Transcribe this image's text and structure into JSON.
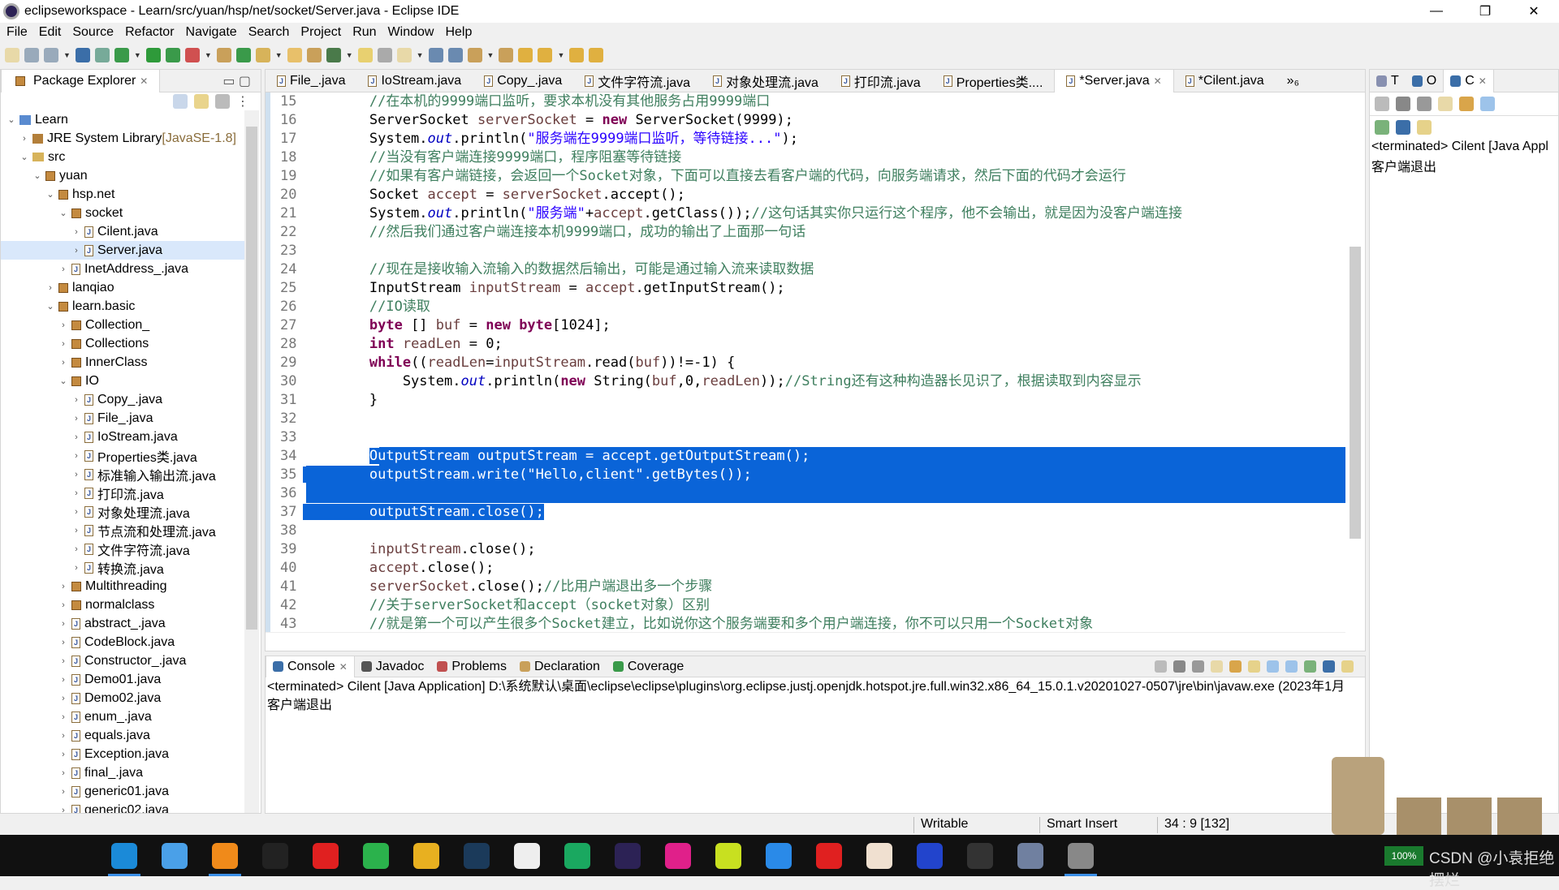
{
  "window": {
    "title": "eclipseworkspace - Learn/src/yuan/hsp/net/socket/Server.java - Eclipse IDE",
    "minimize": "—",
    "maximize": "❐",
    "close": "✕"
  },
  "menu": [
    "File",
    "Edit",
    "Source",
    "Refactor",
    "Navigate",
    "Search",
    "Project",
    "Run",
    "Window",
    "Help"
  ],
  "explorer": {
    "title": "Package Explorer",
    "items": [
      {
        "label": "Learn",
        "level": 0,
        "exp": "v",
        "icon": "proj"
      },
      {
        "label": "JRE System Library",
        "extra": " [JavaSE-1.8]",
        "level": 1,
        "exp": ">",
        "icon": "lib"
      },
      {
        "label": "src",
        "level": 1,
        "exp": "v",
        "icon": "fold"
      },
      {
        "label": "yuan",
        "level": 2,
        "exp": "v",
        "icon": "pkg"
      },
      {
        "label": "hsp.net",
        "level": 3,
        "exp": "v",
        "icon": "pkg"
      },
      {
        "label": "socket",
        "level": 4,
        "exp": "v",
        "icon": "pkg"
      },
      {
        "label": "Cilent.java",
        "level": 5,
        "exp": ">",
        "icon": "java"
      },
      {
        "label": "Server.java",
        "level": 5,
        "exp": ">",
        "icon": "java",
        "selected": true
      },
      {
        "label": "InetAddress_.java",
        "level": 4,
        "exp": ">",
        "icon": "java"
      },
      {
        "label": "lanqiao",
        "level": 3,
        "exp": ">",
        "icon": "pkg"
      },
      {
        "label": "learn.basic",
        "level": 3,
        "exp": "v",
        "icon": "pkg"
      },
      {
        "label": "Collection_",
        "level": 4,
        "exp": ">",
        "icon": "pkg"
      },
      {
        "label": "Collections",
        "level": 4,
        "exp": ">",
        "icon": "pkg"
      },
      {
        "label": "InnerClass",
        "level": 4,
        "exp": ">",
        "icon": "pkg"
      },
      {
        "label": "IO",
        "level": 4,
        "exp": "v",
        "icon": "pkg"
      },
      {
        "label": "Copy_.java",
        "level": 5,
        "exp": ">",
        "icon": "java"
      },
      {
        "label": "File_.java",
        "level": 5,
        "exp": ">",
        "icon": "java"
      },
      {
        "label": "IoStream.java",
        "level": 5,
        "exp": ">",
        "icon": "java"
      },
      {
        "label": "Properties类.java",
        "level": 5,
        "exp": ">",
        "icon": "java"
      },
      {
        "label": "标准输入输出流.java",
        "level": 5,
        "exp": ">",
        "icon": "java"
      },
      {
        "label": "打印流.java",
        "level": 5,
        "exp": ">",
        "icon": "java"
      },
      {
        "label": "对象处理流.java",
        "level": 5,
        "exp": ">",
        "icon": "java"
      },
      {
        "label": "节点流和处理流.java",
        "level": 5,
        "exp": ">",
        "icon": "java"
      },
      {
        "label": "文件字符流.java",
        "level": 5,
        "exp": ">",
        "icon": "java"
      },
      {
        "label": "转换流.java",
        "level": 5,
        "exp": ">",
        "icon": "java"
      },
      {
        "label": "Multithreading",
        "level": 4,
        "exp": ">",
        "icon": "pkg"
      },
      {
        "label": "normalclass",
        "level": 4,
        "exp": ">",
        "icon": "pkg"
      },
      {
        "label": "abstract_.java",
        "level": 4,
        "exp": ">",
        "icon": "java"
      },
      {
        "label": "CodeBlock.java",
        "level": 4,
        "exp": ">",
        "icon": "java"
      },
      {
        "label": "Constructor_.java",
        "level": 4,
        "exp": ">",
        "icon": "java"
      },
      {
        "label": "Demo01.java",
        "level": 4,
        "exp": ">",
        "icon": "java"
      },
      {
        "label": "Demo02.java",
        "level": 4,
        "exp": ">",
        "icon": "java"
      },
      {
        "label": "enum_.java",
        "level": 4,
        "exp": ">",
        "icon": "java"
      },
      {
        "label": "equals.java",
        "level": 4,
        "exp": ">",
        "icon": "java"
      },
      {
        "label": "Exception.java",
        "level": 4,
        "exp": ">",
        "icon": "java"
      },
      {
        "label": "final_.java",
        "level": 4,
        "exp": ">",
        "icon": "java"
      },
      {
        "label": "generic01.java",
        "level": 4,
        "exp": ">",
        "icon": "java"
      },
      {
        "label": "generic02.java",
        "level": 4,
        "exp": ">",
        "icon": "java"
      }
    ]
  },
  "editor": {
    "tabs": [
      {
        "label": "File_.java"
      },
      {
        "label": "IoStream.java"
      },
      {
        "label": "Copy_.java"
      },
      {
        "label": "文件字符流.java"
      },
      {
        "label": "对象处理流.java"
      },
      {
        "label": "打印流.java"
      },
      {
        "label": "Properties类...."
      },
      {
        "label": "*Server.java",
        "active": true
      },
      {
        "label": "*Cilent.java"
      }
    ],
    "overflow": "»₆",
    "lines": [
      {
        "n": "15",
        "t": [
          [
            "c",
            "        //在本机的9999端口监听，要求本机没有其他服务占用9999端口"
          ]
        ]
      },
      {
        "n": "16",
        "t": [
          [
            "p",
            "        ServerSocket "
          ],
          [
            "v",
            "serverSocket"
          ],
          [
            "p",
            " = "
          ],
          [
            "k",
            "new"
          ],
          [
            "p",
            " ServerSocket(9999);"
          ]
        ]
      },
      {
        "n": "17",
        "t": [
          [
            "p",
            "        System."
          ],
          [
            "f",
            "out"
          ],
          [
            "p",
            ".println("
          ],
          [
            "s",
            "\"服务端在9999端口监听，等待链接...\""
          ],
          [
            "p",
            ");"
          ]
        ]
      },
      {
        "n": "18",
        "t": [
          [
            "c",
            "        //当没有客户端连接9999端口，程序阻塞等待链接"
          ]
        ]
      },
      {
        "n": "19",
        "t": [
          [
            "c",
            "        //如果有客户端链接，会返回一个Socket对象，下面可以直接去看客户端的代码，向服务端请求，然后下面的代码才会运行"
          ]
        ]
      },
      {
        "n": "20",
        "t": [
          [
            "p",
            "        Socket "
          ],
          [
            "v",
            "accept"
          ],
          [
            "p",
            " = "
          ],
          [
            "v",
            "serverSocket"
          ],
          [
            "p",
            ".accept();"
          ]
        ]
      },
      {
        "n": "21",
        "t": [
          [
            "p",
            "        System."
          ],
          [
            "f",
            "out"
          ],
          [
            "p",
            ".println("
          ],
          [
            "s",
            "\"服务端\""
          ],
          [
            "p",
            "+"
          ],
          [
            "v",
            "accept"
          ],
          [
            "p",
            ".getClass());"
          ],
          [
            "c",
            "//这句话其实你只运行这个程序，他不会输出，就是因为没客户端连接"
          ]
        ]
      },
      {
        "n": "22",
        "t": [
          [
            "c",
            "        //然后我们通过客户端连接本机9999端口，成功的输出了上面那一句话"
          ]
        ]
      },
      {
        "n": "23",
        "t": []
      },
      {
        "n": "24",
        "t": [
          [
            "c",
            "        //现在是接收输入流输入的数据然后输出，可能是通过输入流来读取数据"
          ]
        ]
      },
      {
        "n": "25",
        "t": [
          [
            "p",
            "        InputStream "
          ],
          [
            "v",
            "inputStream"
          ],
          [
            "p",
            " = "
          ],
          [
            "v",
            "accept"
          ],
          [
            "p",
            ".getInputStream();"
          ]
        ]
      },
      {
        "n": "26",
        "t": [
          [
            "c",
            "        //IO读取"
          ]
        ]
      },
      {
        "n": "27",
        "t": [
          [
            "k",
            "        byte"
          ],
          [
            "p",
            " [] "
          ],
          [
            "v",
            "buf"
          ],
          [
            "p",
            " = "
          ],
          [
            "k",
            "new"
          ],
          [
            "p",
            " "
          ],
          [
            "k",
            "byte"
          ],
          [
            "p",
            "[1024];"
          ]
        ]
      },
      {
        "n": "28",
        "t": [
          [
            "k",
            "        int"
          ],
          [
            "p",
            " "
          ],
          [
            "v",
            "readLen"
          ],
          [
            "p",
            " = 0;"
          ]
        ]
      },
      {
        "n": "29",
        "t": [
          [
            "k",
            "        while"
          ],
          [
            "p",
            "(("
          ],
          [
            "v",
            "readLen"
          ],
          [
            "p",
            "="
          ],
          [
            "v",
            "inputStream"
          ],
          [
            "p",
            ".read("
          ],
          [
            "v",
            "buf"
          ],
          [
            "p",
            "))!=-1) {"
          ]
        ]
      },
      {
        "n": "30",
        "t": [
          [
            "p",
            "            System."
          ],
          [
            "f",
            "out"
          ],
          [
            "p",
            ".println("
          ],
          [
            "k",
            "new"
          ],
          [
            "p",
            " String("
          ],
          [
            "v",
            "buf"
          ],
          [
            "p",
            ",0,"
          ],
          [
            "v",
            "readLen"
          ],
          [
            "p",
            "));"
          ],
          [
            "c",
            "//String还有这种构造器长见识了，根据读取到内容显示"
          ]
        ]
      },
      {
        "n": "31",
        "t": [
          [
            "p",
            "        }"
          ]
        ]
      },
      {
        "n": "32",
        "t": []
      },
      {
        "n": "33",
        "t": []
      },
      {
        "n": "34",
        "sel": "start",
        "t": [
          [
            "p",
            "        "
          ],
          [
            "sel",
            "OutputStream outputStream = accept.getOutputStream();"
          ]
        ]
      },
      {
        "n": "35",
        "sel": "full",
        "t": [
          [
            "sel",
            "        outputStream.write(\"Hello,client\".getBytes());"
          ]
        ]
      },
      {
        "n": "36",
        "sel": "full",
        "t": []
      },
      {
        "n": "37",
        "sel": "end",
        "t": [
          [
            "sel",
            "        outputStream.close();"
          ]
        ]
      },
      {
        "n": "38",
        "t": []
      },
      {
        "n": "39",
        "t": [
          [
            "v",
            "        inputStream"
          ],
          [
            "p",
            ".close();"
          ]
        ]
      },
      {
        "n": "40",
        "t": [
          [
            "v",
            "        accept"
          ],
          [
            "p",
            ".close();"
          ]
        ]
      },
      {
        "n": "41",
        "t": [
          [
            "v",
            "        serverSocket"
          ],
          [
            "p",
            ".close();"
          ],
          [
            "c",
            "//比用户端退出多一个步骤"
          ]
        ]
      },
      {
        "n": "42",
        "t": [
          [
            "c",
            "        //关于serverSocket和accept（socket对象）区别"
          ]
        ]
      },
      {
        "n": "43",
        "t": [
          [
            "c",
            "        //就是第一个可以产生很多个Socket建立，比如说你这个服务端要和多个用户端连接，你不可以只用一个Socket对象"
          ]
        ]
      }
    ]
  },
  "console": {
    "tabs": [
      {
        "label": "Console",
        "icon": "console-icon",
        "active": true
      },
      {
        "label": "Javadoc",
        "icon": "javadoc-icon"
      },
      {
        "label": "Problems",
        "icon": "problems-icon"
      },
      {
        "label": "Declaration",
        "icon": "declaration-icon"
      },
      {
        "label": "Coverage",
        "icon": "coverage-icon"
      }
    ],
    "header": "<terminated> Cilent [Java Application] D:\\系统默认\\桌面\\eclipse\\eclipse\\plugins\\org.eclipse.justj.openjdk.hotspot.jre.full.win32.x86_64_15.0.1.v20201027-0507\\jre\\bin\\javaw.exe  (2023年1月",
    "output": "客户端退出"
  },
  "right": {
    "tabs": [
      "T",
      "O",
      "C"
    ],
    "header": "<terminated> Cilent [Java Appl",
    "output": "客户端退出"
  },
  "status": {
    "mode": "Writable",
    "insert": "Smart Insert",
    "position": "34 : 9 [132]"
  },
  "taskbar": {
    "apps": [
      "edge",
      "files",
      "search",
      "epic-games",
      "netease-music",
      "wechat",
      "chrome",
      "steam",
      "app-lightning",
      "app-green",
      "eclipse",
      "intellij-idea",
      "pycharm",
      "vscode",
      "qq",
      "anime-app",
      "app-v4",
      "game-box",
      "app-bug",
      "eclipse-running"
    ],
    "tray_battery": "100%",
    "watermark": "CSDN @小袁拒绝摆烂"
  },
  "colors": {
    "selection": "#0a64d8",
    "keyword": "#7f0055",
    "comment": "#3f7f5f",
    "string": "#2a00ff",
    "field": "#0000c0",
    "local": "#6a3e3e"
  }
}
